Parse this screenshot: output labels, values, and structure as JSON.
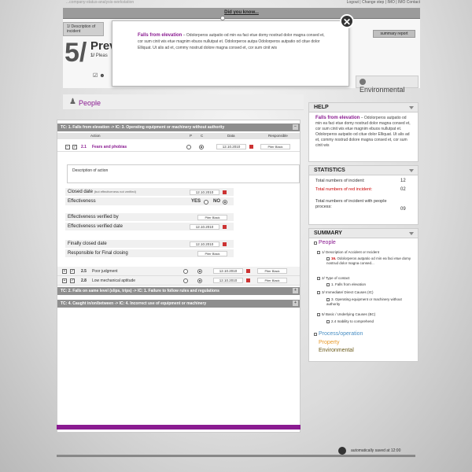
{
  "topbar": {
    "links": "Logout | Change step | IMO | IMO Contact",
    "left_text": "...company-status-analysis-workstation"
  },
  "dyk": {
    "label": "Did you know..."
  },
  "popup": {
    "title": "Falls from elevation",
    "text": " – Odolorperos autpatio od  min ea faci etue domy nostrud dolor magna consed et, cor sum cinit wis etue magnim ebuos nullutpat et. Odolorperos autpa Odolorperos autpatio od  citue dolor Elliquat. Ut alis ad et, commy nostrud dolore magna consed et, cor sum cinit wis"
  },
  "step": {
    "tab": "1/ Description of incident",
    "number": "5/",
    "title": "Prev",
    "sub_num": "1/",
    "sub": "Pleas"
  },
  "summary_button": "summary report",
  "env_tab": "Environmental",
  "people": {
    "title": "People"
  },
  "tc1": {
    "text": "TC: 1. Falls from elevation -> IC: 3. Operating equipment or machinery without authority"
  },
  "cols": {
    "action": "Action",
    "p": "P",
    "c": "C",
    "date": "Data",
    "resp": "Responsible"
  },
  "row1": {
    "num": "2.1",
    "name": "Fears and phobias",
    "date": "12.10.2010",
    "resp": "Piter Black"
  },
  "desc": {
    "placeholder": "Description of action"
  },
  "fields": {
    "closed": "Closed date",
    "closed_note": "(but effectiveness not verified)",
    "closed_date": "12.10.2010",
    "effectiveness": "Effectiveness",
    "yes": "YES",
    "no": "NO",
    "verified_by": "Effectiveness verified by",
    "verified_by_val": "Piter Black",
    "verified_date": "Effectiveness verified date",
    "verified_date_val": "12.10.2010",
    "final_closed": "Finally closed date",
    "final_closed_val": "12.10.2010",
    "responsible": "Responsible for Final closing",
    "responsible_val": "Piter Black"
  },
  "row2": {
    "num": "2.5",
    "name": "Poor judgment",
    "date": "12.10.2010",
    "resp": "Piter Black"
  },
  "row3": {
    "num": "2.8",
    "name": "Low mechanical aptitude",
    "date": "12.10.2010",
    "resp": "Piter Black"
  },
  "tc2": {
    "text": "TC: 2. Falls on same level (slips, trips) -> IC: 1. Failure to follow rules and regulations"
  },
  "tc3": {
    "text": "TC: 4. Caught in/on/between -> IC: 4. Incorrect use of equipment or machinery"
  },
  "help": {
    "title": "HELP",
    "hl": "Falls from elevation",
    "text": " – Odolorperos autpatio od  min ea faci etue domy nostrud dolor magna consed et, cor sum cinit wis etue magnim ebuos nullutpat et. Odolorperos autpatio od  citue dolor Elliquat. Ut alis ad et, commy nostrud dolore magna consed et, cor sum cinit wis"
  },
  "stats": {
    "title": "STATISTICS",
    "total_label": "Total numbers of incident:",
    "total": "12",
    "red_label": "Total numbers of red incident:",
    "red": "02",
    "people_label": "Total numbers of incident with people process:",
    "people": "09"
  },
  "summary": {
    "title": "SUMMARY",
    "people": "People",
    "l1": "1/ Description of Accident or Incident",
    "l1a_num": "16.",
    "l1a": "Odolorperos autpatio od  min ea faci etue domy nostrud dolor magna consed...",
    "l2": "2/ Type of contact",
    "l2a": "1. Falls from elevation",
    "l3": "3/ Immediate/ Direct Causes (IC)",
    "l3a": "3. Operating equipment or machinery without authority",
    "l4": "5/ Basic / Underlying Causes (BC)",
    "l4a": "2.4 Inability to comprehend",
    "proc": "Process/operation",
    "property": "Property",
    "env": "Environmental"
  },
  "footer": {
    "autosave": "automatically saved at 12:00"
  },
  "colors": {
    "accent": "#8a1b91",
    "orange": "#e89a2a",
    "blue": "#4a8fc4",
    "olive": "#6b5a1a"
  }
}
